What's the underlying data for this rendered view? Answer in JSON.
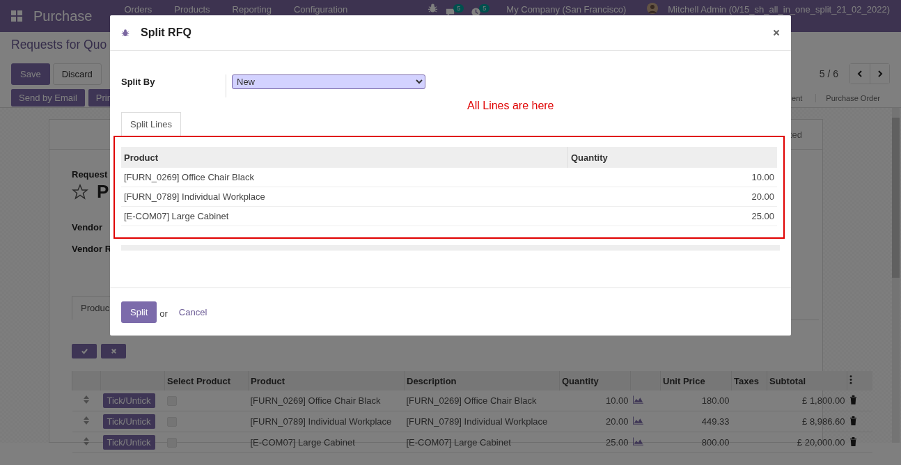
{
  "navbar": {
    "app_name": "Purchase",
    "menu": [
      "Orders",
      "Products",
      "Reporting",
      "Configuration"
    ],
    "chat_count": "5",
    "activity_count": "5",
    "company": "My Company (San Francisco)",
    "user": "Mitchell Admin (0/15_sh_all_in_one_split_21_02_2022)"
  },
  "breadcrumb": "Requests for Quo",
  "edit_buttons": [
    "Save",
    "Discard"
  ],
  "pager": "5 / 6",
  "action_buttons": [
    "Send by Email",
    "Prin"
  ],
  "status_steps": [
    {
      "label": "ent",
      "selected": false
    },
    {
      "label": "Purchase Order",
      "selected": false
    }
  ],
  "sheet": {
    "header_fragment": "ted",
    "title_label": "Request",
    "title": "P",
    "starred": false,
    "fields": [
      "Vendor",
      "Vendor R"
    ],
    "tabs": [
      {
        "label": "Produc",
        "selected": true
      }
    ]
  },
  "order_lines": {
    "columns": [
      "Select Product",
      "Product",
      "Description",
      "Quantity",
      "Unit Price",
      "Taxes",
      "Subtotal"
    ],
    "rows": [
      {
        "button": "Tick/Untick",
        "selected": false,
        "product": "[FURN_0269] Office Chair Black",
        "description": "[FURN_0269] Office Chair Black",
        "quantity": "10.00",
        "unit_price": "180.00",
        "subtotal": "£ 1,800.00"
      },
      {
        "button": "Tick/Untick",
        "selected": false,
        "product": "[FURN_0789] Individual Workplace",
        "description": "[FURN_0789] Individual Workplace",
        "quantity": "20.00",
        "unit_price": "449.33",
        "subtotal": "£ 8,986.60"
      },
      {
        "button": "Tick/Untick",
        "selected": false,
        "product": "[E-COM07] Large Cabinet",
        "description": "[E-COM07] Large Cabinet",
        "quantity": "25.00",
        "unit_price": "800.00",
        "subtotal": "£ 20,000.00"
      }
    ]
  },
  "dialog": {
    "title": "Split RFQ",
    "split_by_label": "Split By",
    "split_by_value": "New",
    "annotation": "All Lines are here",
    "tabs": [
      {
        "label": "Split Lines",
        "selected": true
      }
    ],
    "columns": [
      "Product",
      "Quantity"
    ],
    "rows": [
      [
        "[FURN_0269] Office Chair Black",
        "10.00"
      ],
      [
        "[FURN_0789] Individual Workplace",
        "20.00"
      ],
      [
        "[E-COM07] Large Cabinet",
        "25.00"
      ]
    ],
    "split_button": "Split",
    "or_text": "or",
    "cancel": "Cancel"
  }
}
